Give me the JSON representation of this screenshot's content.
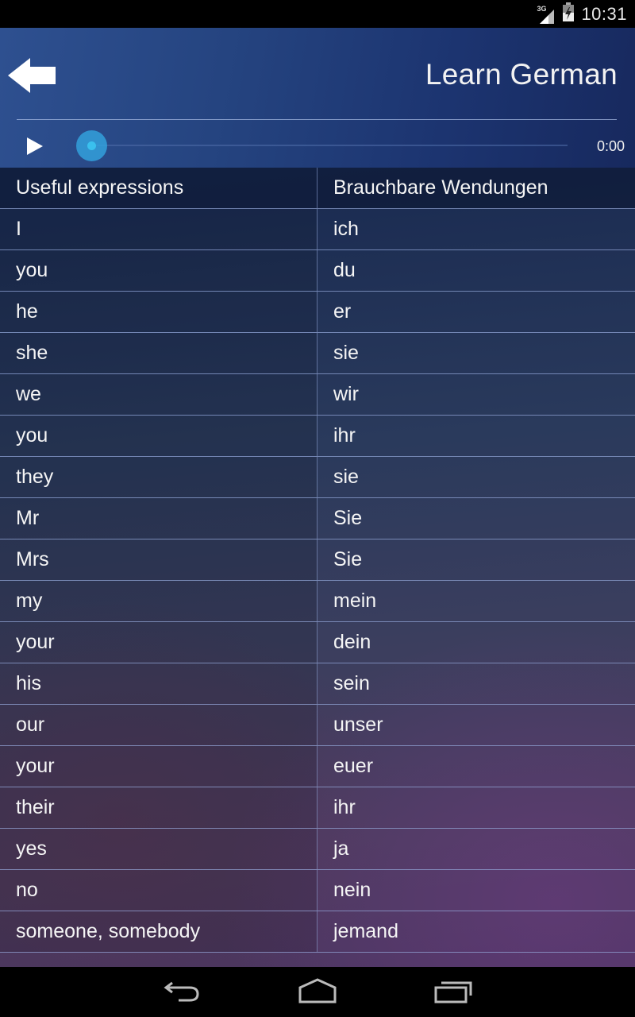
{
  "status_bar": {
    "network_label": "3G",
    "time": "10:31"
  },
  "header": {
    "title": "Learn German",
    "back_icon": "arrow-left-icon"
  },
  "player": {
    "play_icon": "play-icon",
    "progress": 0,
    "time": "0:00"
  },
  "table": {
    "headers": [
      "Useful expressions",
      "Brauchbare Wendungen"
    ],
    "rows": [
      [
        "I",
        "ich"
      ],
      [
        "you",
        "du"
      ],
      [
        "he",
        "er"
      ],
      [
        "she",
        "sie"
      ],
      [
        "we",
        "wir"
      ],
      [
        "you",
        "ihr"
      ],
      [
        "they",
        "sie"
      ],
      [
        "Mr",
        "Sie"
      ],
      [
        "Mrs",
        "Sie"
      ],
      [
        "my",
        "mein"
      ],
      [
        "your",
        "dein"
      ],
      [
        "his",
        "sein"
      ],
      [
        "our",
        "unser"
      ],
      [
        "your",
        "euer"
      ],
      [
        "their",
        "ihr"
      ],
      [
        "yes",
        "ja"
      ],
      [
        "no",
        "nein"
      ],
      [
        "someone, somebody",
        "jemand"
      ]
    ]
  },
  "nav_bar": {
    "back_icon": "nav-back-icon",
    "home_icon": "nav-home-icon",
    "recents_icon": "nav-recents-icon"
  },
  "colors": {
    "header_blue": "#254480",
    "seek_accent": "#3ac0ee"
  }
}
